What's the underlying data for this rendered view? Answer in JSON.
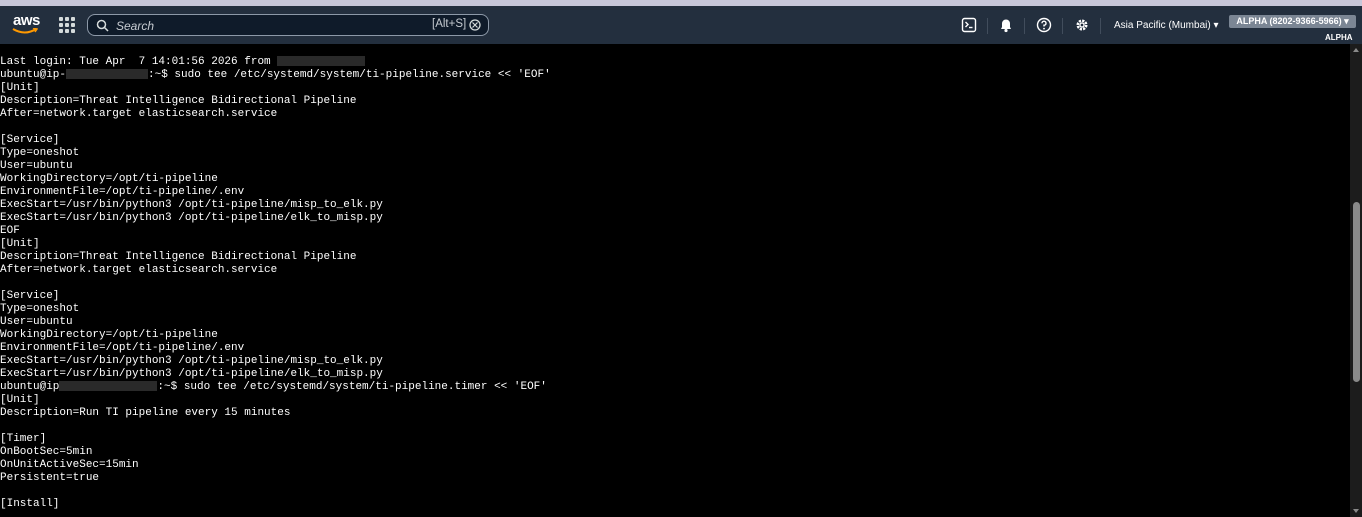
{
  "header": {
    "logo_text": "aws",
    "search": {
      "placeholder": "Search",
      "shortcut": "[Alt+S]"
    },
    "icons": [
      "cloudshell-icon",
      "bell-icon",
      "help-icon",
      "gear-icon"
    ],
    "region_label": "Asia Pacific (Mumbai) ▾",
    "account_label": "ALPHA (8202-9366-5966) ▾",
    "stage_label": "ALPHA",
    "colors": {
      "header_bg": "#232f3e",
      "terminal_bg": "#000000",
      "text": "#ffffff"
    }
  },
  "terminal": {
    "lines": [
      {
        "text": "Last login: Tue Apr  7 14:01:56 2026 from "
      },
      {
        "text": "ubuntu@ip-",
        "after": ":~$ sudo tee /etc/systemd/system/ti-pipeline.service << 'EOF'"
      },
      {
        "text": "[Unit]"
      },
      {
        "text": "Description=Threat Intelligence Bidirectional Pipeline"
      },
      {
        "text": "After=network.target elasticsearch.service"
      },
      {
        "text": ""
      },
      {
        "text": "[Service]"
      },
      {
        "text": "Type=oneshot"
      },
      {
        "text": "User=ubuntu"
      },
      {
        "text": "WorkingDirectory=/opt/ti-pipeline"
      },
      {
        "text": "EnvironmentFile=/opt/ti-pipeline/.env"
      },
      {
        "text": "ExecStart=/usr/bin/python3 /opt/ti-pipeline/misp_to_elk.py"
      },
      {
        "text": "ExecStart=/usr/bin/python3 /opt/ti-pipeline/elk_to_misp.py"
      },
      {
        "text": "EOF"
      },
      {
        "text": "[Unit]"
      },
      {
        "text": "Description=Threat Intelligence Bidirectional Pipeline"
      },
      {
        "text": "After=network.target elasticsearch.service"
      },
      {
        "text": ""
      },
      {
        "text": "[Service]"
      },
      {
        "text": "Type=oneshot"
      },
      {
        "text": "User=ubuntu"
      },
      {
        "text": "WorkingDirectory=/opt/ti-pipeline"
      },
      {
        "text": "EnvironmentFile=/opt/ti-pipeline/.env"
      },
      {
        "text": "ExecStart=/usr/bin/python3 /opt/ti-pipeline/misp_to_elk.py"
      },
      {
        "text": "ExecStart=/usr/bin/python3 /opt/ti-pipeline/elk_to_misp.py"
      },
      {
        "text": "ubuntu@ip",
        "after": ":~$ sudo tee /etc/systemd/system/ti-pipeline.timer << 'EOF'"
      },
      {
        "text": "[Unit]"
      },
      {
        "text": "Description=Run TI pipeline every 15 minutes"
      },
      {
        "text": ""
      },
      {
        "text": "[Timer]"
      },
      {
        "text": "OnBootSec=5min"
      },
      {
        "text": "OnUnitActiveSec=15min"
      },
      {
        "text": "Persistent=true"
      },
      {
        "text": ""
      },
      {
        "text": "[Install]"
      }
    ]
  }
}
